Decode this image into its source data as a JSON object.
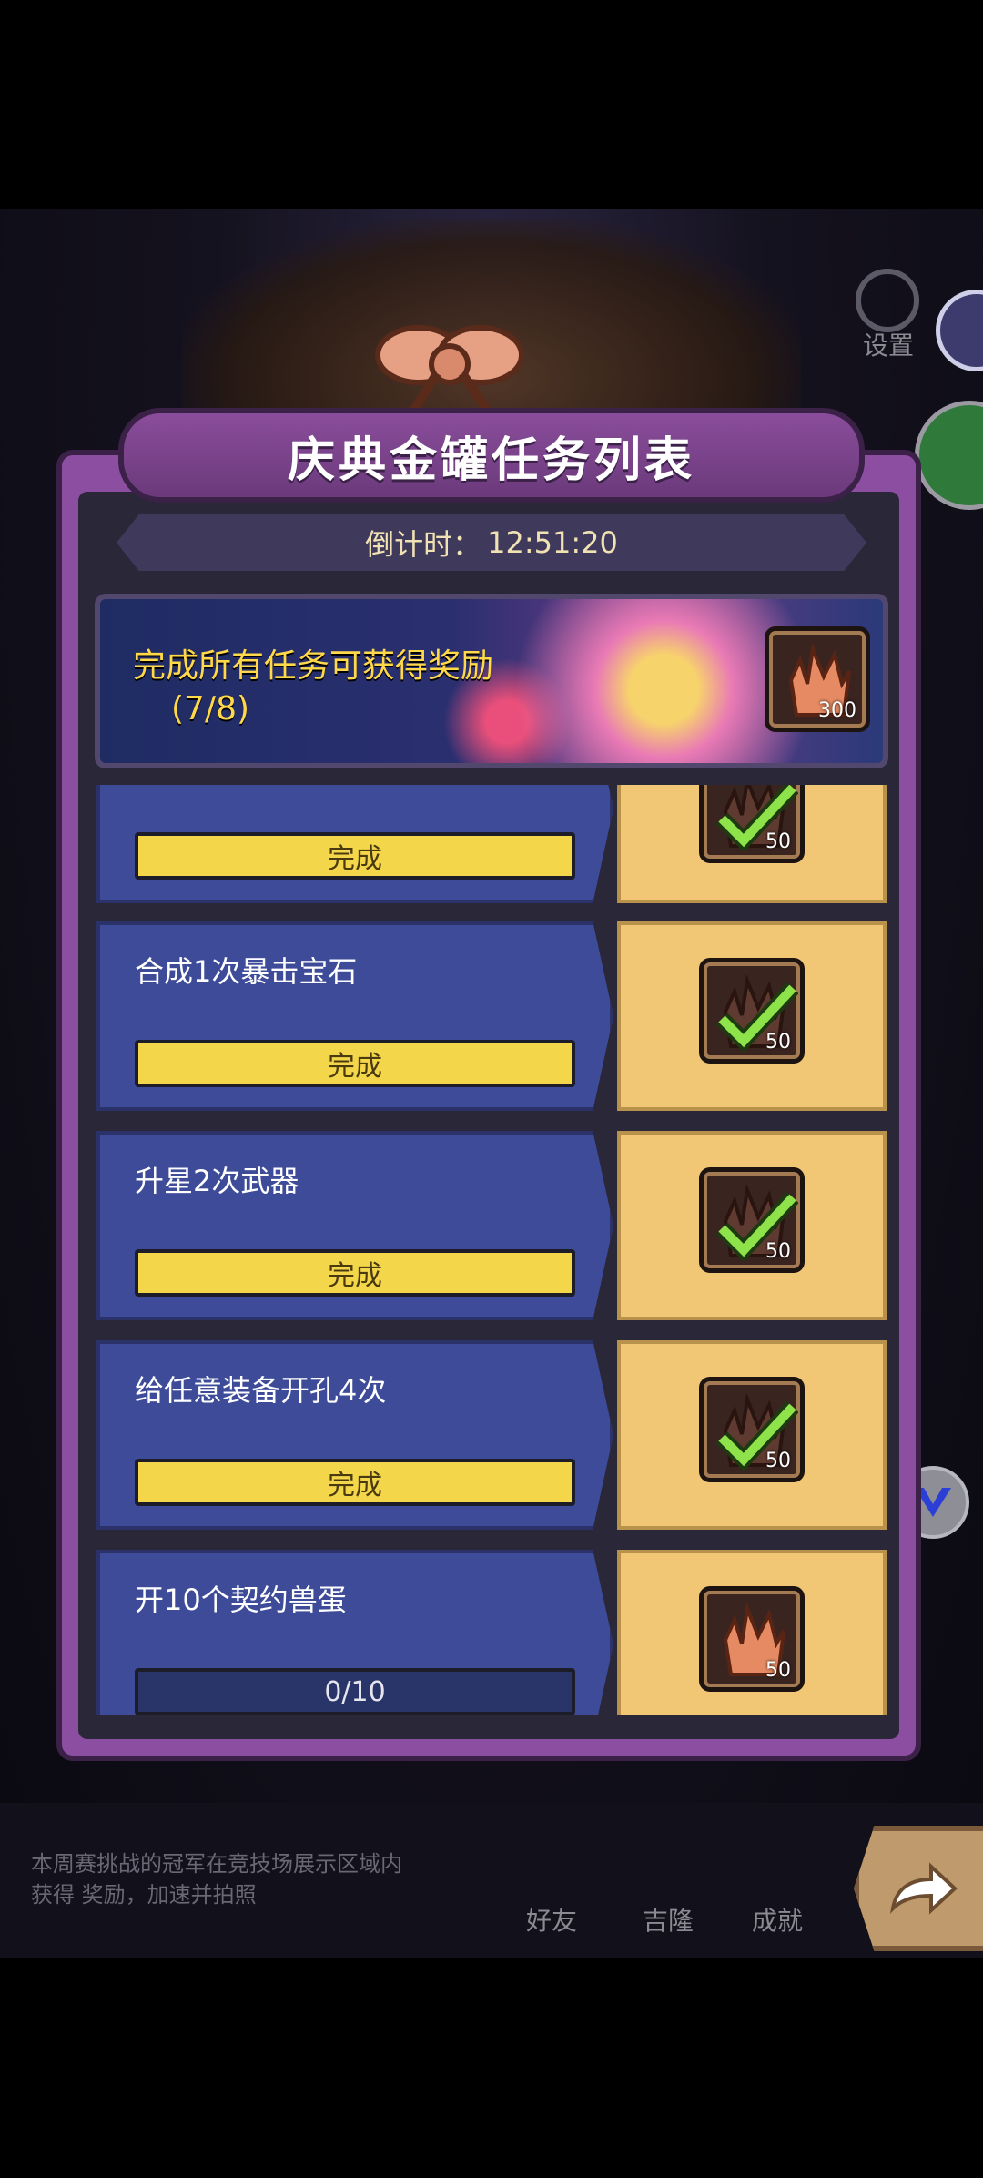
{
  "background": {
    "settings_label": "设置",
    "bottom_nav": [
      "好友",
      "吉隆",
      "成就"
    ],
    "chat_text": "本周赛挑战的冠军在竞技场展示区域内获得 奖励，加速并拍照"
  },
  "panel": {
    "title": "庆典金罐任务列表",
    "countdown_label": "倒计时：",
    "countdown_value": "12:51:20"
  },
  "reward_banner": {
    "text": "完成所有任务可获得奖励",
    "progress": "(7/8)",
    "reward_qty": "300"
  },
  "tasks": [
    {
      "name": "",
      "status": "完成",
      "reward_qty": "50",
      "completed": true
    },
    {
      "name": "合成1次暴击宝石",
      "status": "完成",
      "reward_qty": "50",
      "completed": true
    },
    {
      "name": "升星2次武器",
      "status": "完成",
      "reward_qty": "50",
      "completed": true
    },
    {
      "name": "给任意装备开孔4次",
      "status": "完成",
      "reward_qty": "50",
      "completed": true
    },
    {
      "name": "开10个契约兽蛋",
      "status": "0/10",
      "reward_qty": "50",
      "completed": false
    }
  ],
  "colors": {
    "panel_purple": "#8c4ea0",
    "task_blue": "#3d4b98",
    "reward_gold": "#f1c775",
    "done_bar": "#f4d64a",
    "check_green": "#8fe34a"
  }
}
